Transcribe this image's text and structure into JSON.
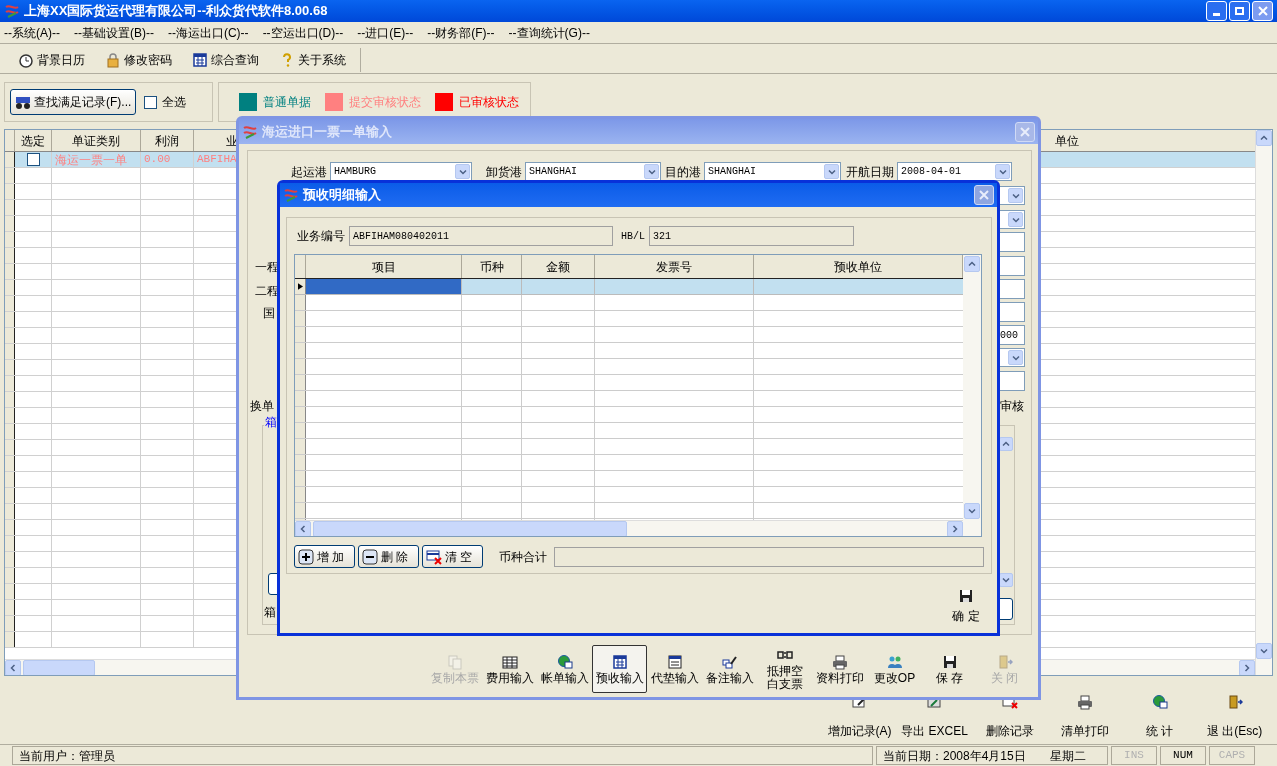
{
  "window": {
    "title": "上海XX国际货运代理有限公司--利众货代软件8.00.68"
  },
  "menu": [
    "--系统(A)--",
    "--基础设置(B)--",
    "--海运出口(C)--",
    "--空运出口(D)--",
    "--进口(E)--",
    "--财务部(F)--",
    "--查询统计(G)--"
  ],
  "toolbar": [
    {
      "label": "背景日历",
      "kind": "clock"
    },
    {
      "label": "修改密码",
      "kind": "lock"
    },
    {
      "label": "综合查询",
      "kind": "calendar"
    },
    {
      "label": "关于系统",
      "kind": "help"
    }
  ],
  "search_button": "查找满足记录(F)...",
  "select_all": {
    "label": "全选",
    "checked": false
  },
  "legend": [
    {
      "label": "普通单据",
      "color": "#008080"
    },
    {
      "label": "提交审核状态",
      "color": "#ff8080"
    },
    {
      "label": "已审核状态",
      "color": "#ff0000"
    }
  ],
  "grid": {
    "checkbox_column": "选定",
    "columns": [
      "单证类别",
      "利润",
      "业"
    ],
    "far_column": "单位",
    "rows": [
      {
        "selected": true,
        "checked": false,
        "color": "#ff8080",
        "cells": [
          "海运一票一单",
          "0.00",
          "ABFIHA"
        ]
      }
    ]
  },
  "actions": [
    {
      "label": "增加记录(A)",
      "kind": "add"
    },
    {
      "label": "导出 EXCEL",
      "kind": "excel"
    },
    {
      "label": "删除记录",
      "kind": "delete"
    },
    {
      "label": "清单打印",
      "kind": "print"
    },
    {
      "label": "统 计",
      "kind": "stats"
    },
    {
      "label": "退 出(Esc)",
      "kind": "exit"
    }
  ],
  "status_bar": {
    "user": "当前用户：管理员",
    "date": "当前日期：2008年4月15日",
    "weekday": "星期二",
    "indicators": [
      {
        "label": "INS",
        "on": false
      },
      {
        "label": "NUM",
        "on": true
      },
      {
        "label": "CAPS",
        "on": false
      }
    ]
  },
  "entry_dialog": {
    "title": "海运进口一票一单输入",
    "fields": [
      {
        "label": "起运港",
        "value": "HAMBURG"
      },
      {
        "label": "卸货港",
        "value": "SHANGHAI"
      },
      {
        "label": "目的港",
        "value": "SHANGHAI"
      },
      {
        "label": "开航日期",
        "value": "2008-04-01"
      }
    ],
    "fragments": [
      {
        "text": "一程",
        "kind": "label"
      },
      {
        "text": "二程",
        "kind": "label"
      },
      {
        "text": "国",
        "kind": "label"
      },
      {
        "text": "000",
        "kind": "field"
      },
      {
        "text": "换单",
        "kind": "label"
      },
      {
        "text": "审核",
        "kind": "label"
      },
      {
        "text": "箱",
        "kind": "group-title"
      },
      {
        "text": "箱",
        "kind": "label"
      }
    ],
    "actions": [
      {
        "label": "复制本票",
        "kind": "copy",
        "disabled": true,
        "selected": false
      },
      {
        "label": "费用输入",
        "kind": "table",
        "disabled": false,
        "selected": false
      },
      {
        "label": "帐单输入",
        "kind": "globe",
        "disabled": false,
        "selected": false
      },
      {
        "label": "预收输入",
        "kind": "calendar",
        "disabled": false,
        "selected": true
      },
      {
        "label": "代垫输入",
        "kind": "form",
        "disabled": false,
        "selected": false
      },
      {
        "label": "备注输入",
        "kind": "note",
        "disabled": false,
        "selected": false
      },
      {
        "label": "抵押空白支票",
        "kind": "voucher",
        "disabled": false,
        "selected": false
      },
      {
        "label": "资料打印",
        "kind": "print",
        "disabled": false,
        "selected": false
      },
      {
        "label": "更改OP",
        "kind": "users",
        "disabled": false,
        "selected": false
      },
      {
        "label": "保 存",
        "kind": "save",
        "disabled": false,
        "selected": false
      },
      {
        "label": "关 闭",
        "kind": "exit",
        "disabled": true,
        "selected": false
      }
    ]
  },
  "receipt_dialog": {
    "title": "预收明细输入",
    "business_no": {
      "label": "业务编号",
      "value": "ABFIHAM080402011"
    },
    "hbl": {
      "label": "HB/L",
      "value": "321"
    },
    "table": {
      "columns": [
        "项目",
        "币种",
        "金额",
        "发票号",
        "预收单位"
      ],
      "rows": [
        {
          "selected": true
        }
      ]
    },
    "buttons": [
      {
        "label": "增 加",
        "kind": "plus"
      },
      {
        "label": "删 除",
        "kind": "minus"
      },
      {
        "label": "清 空",
        "kind": "clear"
      }
    ],
    "total_label": "币种合计",
    "ok_button": "确 定"
  }
}
